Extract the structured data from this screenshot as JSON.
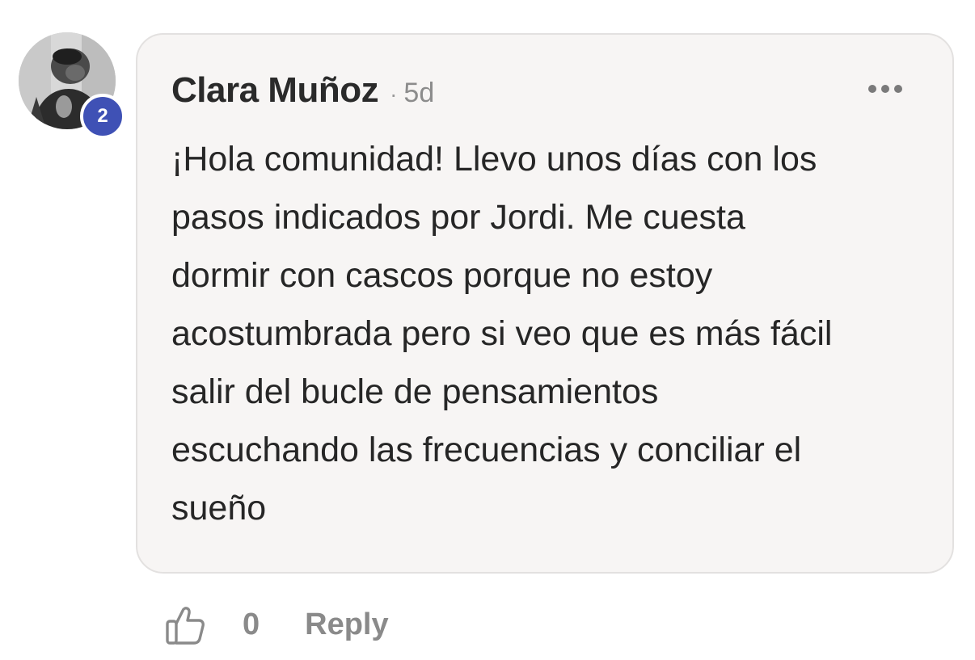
{
  "author": {
    "name": "Clara Muñoz",
    "badge": "2"
  },
  "comment": {
    "separator": "·",
    "time": "5d",
    "text": "¡Hola comunidad! Llevo unos días con los\npasos indicados por Jordi. Me cuesta\ndormir con cascos porque no estoy\nacostumbrada pero si veo que es más fácil\nsalir del bucle de pensamientos\nescuchando las frecuencias y conciliar el\nsueño"
  },
  "actions": {
    "like_count": "0",
    "reply_label": "Reply"
  },
  "icons": {
    "like": "thumbs-up-icon",
    "more": "more-options-icon"
  },
  "colors": {
    "badge": "#3f51b5",
    "bubble": "#f7f5f4",
    "text": "#262626",
    "muted": "#8a8a8a"
  }
}
